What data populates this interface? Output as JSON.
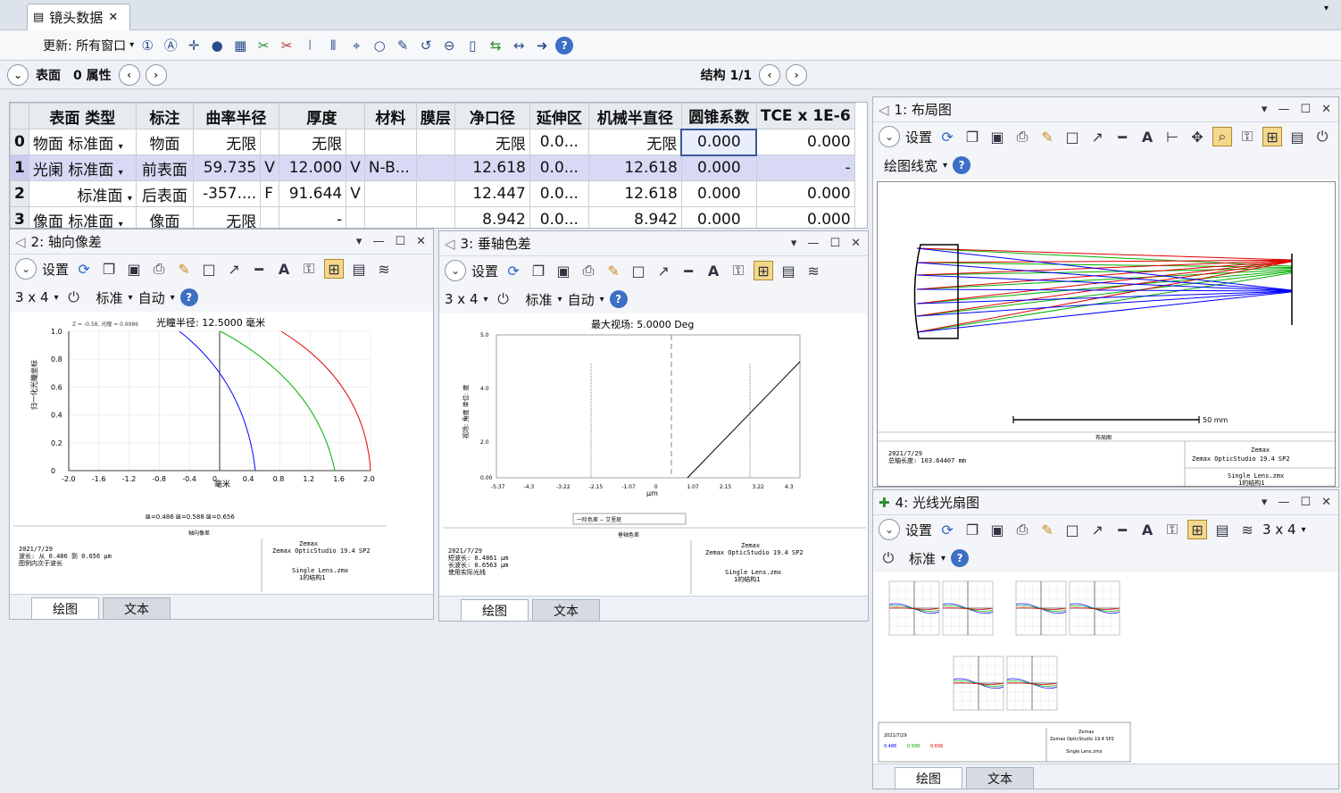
{
  "tab": {
    "title": "镜头数据"
  },
  "toolbar": {
    "update_label": "更新: 所有窗口"
  },
  "surfbar": {
    "surface_label": "表面",
    "props_label": "0 属性",
    "config_label": "结构 1/1"
  },
  "lde": {
    "headers": [
      "表面 类型",
      "标注",
      "曲率半径",
      "厚度",
      "材料",
      "膜层",
      "净口径",
      "延伸区",
      "机械半直径",
      "圆锥系数",
      "TCE x 1E-6"
    ],
    "rows": [
      {
        "num": "0",
        "name": "物面",
        "type": "标准面",
        "label": "物面",
        "radius": "无限",
        "rmark": "",
        "thick": "无限",
        "tmark": "",
        "mat": "",
        "clear": "无限",
        "ext": "0.0...",
        "mech": "无限",
        "conic": "0.000",
        "tce": "0.000"
      },
      {
        "num": "1",
        "name": "光阑",
        "type": "标准面",
        "label": "前表面",
        "radius": "59.735",
        "rmark": "V",
        "thick": "12.000",
        "tmark": "V",
        "mat": "N-B...",
        "clear": "12.618",
        "ext": "0.0...",
        "mech": "12.618",
        "conic": "0.000",
        "tce": "-"
      },
      {
        "num": "2",
        "name": "",
        "type": "标准面",
        "label": "后表面",
        "radius": "-357....",
        "rmark": "F",
        "thick": "91.644",
        "tmark": "V",
        "mat": "",
        "clear": "12.447",
        "ext": "0.0...",
        "mech": "12.618",
        "conic": "0.000",
        "tce": "0.000"
      },
      {
        "num": "3",
        "name": "像面",
        "type": "标准面",
        "label": "像面",
        "radius": "无限",
        "rmark": "",
        "thick": "-",
        "tmark": "",
        "mat": "",
        "clear": "8.942",
        "ext": "0.0...",
        "mech": "8.942",
        "conic": "0.000",
        "tce": "0.000"
      }
    ]
  },
  "common": {
    "settings": "设置",
    "grid": "3 x 4",
    "std": "标准",
    "auto": "自动",
    "line_width": "绘图线宽",
    "tab_plot": "绘图",
    "tab_text": "文本"
  },
  "p2": {
    "title": "2: 轴向像差",
    "plot_title": "光瞳半径: 12.5000 毫米",
    "small_header": "Z = -0.58, 光瞳 = 0.9986",
    "ylabel": "归一化光瞳坐标",
    "xlabel": "毫米",
    "xticks": [
      "-2.0",
      "-1.6",
      "-1.2",
      "-0.8",
      "-0.4",
      "0",
      "0.4",
      "0.8",
      "1.2",
      "1.6",
      "2.0"
    ],
    "yticks": [
      "1.0",
      "0.8",
      "0.6",
      "0.4",
      "0.2",
      "0"
    ],
    "legend": [
      "0.486",
      "0.588",
      "0.656"
    ],
    "footer_center": "轴向像差",
    "footer_left": [
      "2021/7/29",
      "波长: 从 0.486 到 0.656 μm",
      "图例内次于波长"
    ],
    "footer_right": [
      "Zemax",
      "Zemax OpticStudio 19.4 SP2",
      "Single Lens.zmx",
      "1的结构1"
    ]
  },
  "p3": {
    "title": "3: 垂轴色差",
    "plot_title": "最大视场: 5.0000 Deg",
    "ylabel": "视场: 角度 单位: 度",
    "xlabel": "μm",
    "xticks": [
      "-5.37",
      "-4.3",
      "-3.22",
      "-2.15",
      "-1.07",
      "0",
      "1.07",
      "2.15",
      "3.22",
      "4.3"
    ],
    "yticks": [
      "5.0",
      "4.0",
      "2.0",
      "0.00"
    ],
    "legend": "一阶色差  -- 艾里斑",
    "footer_center": "垂轴色差",
    "footer_left": [
      "2021/7/29",
      "短波长: 0.4861 μm",
      "长波长: 0.6563 μm",
      "使用实际光线"
    ],
    "footer_right": [
      "Zemax",
      "Zemax OpticStudio 19.4 SP2",
      "Single Lens.zmx",
      "1的结构1"
    ]
  },
  "p1": {
    "title": "1: 布局图",
    "scale": "50 mm",
    "footer_center": "布局图",
    "footer_left": [
      "2021/7/29",
      "总轴长度: 103.64407 mm"
    ],
    "footer_right": [
      "Zemax",
      "Zemax OpticStudio 19.4 SP2",
      "Single Lens.zmx",
      "1的结构1"
    ]
  },
  "p4": {
    "title": "4: 光线光扇图",
    "footer_right": [
      "Zemax",
      "Zemax OpticStudio 19.4 SP2",
      "Single Lens.zmx"
    ],
    "footer_left": [
      "2021/7/29",
      "0.486",
      "0.588",
      "0.656"
    ]
  },
  "colors": {
    "blue": "#0000ff",
    "green": "#00b000",
    "red": "#e00000"
  }
}
